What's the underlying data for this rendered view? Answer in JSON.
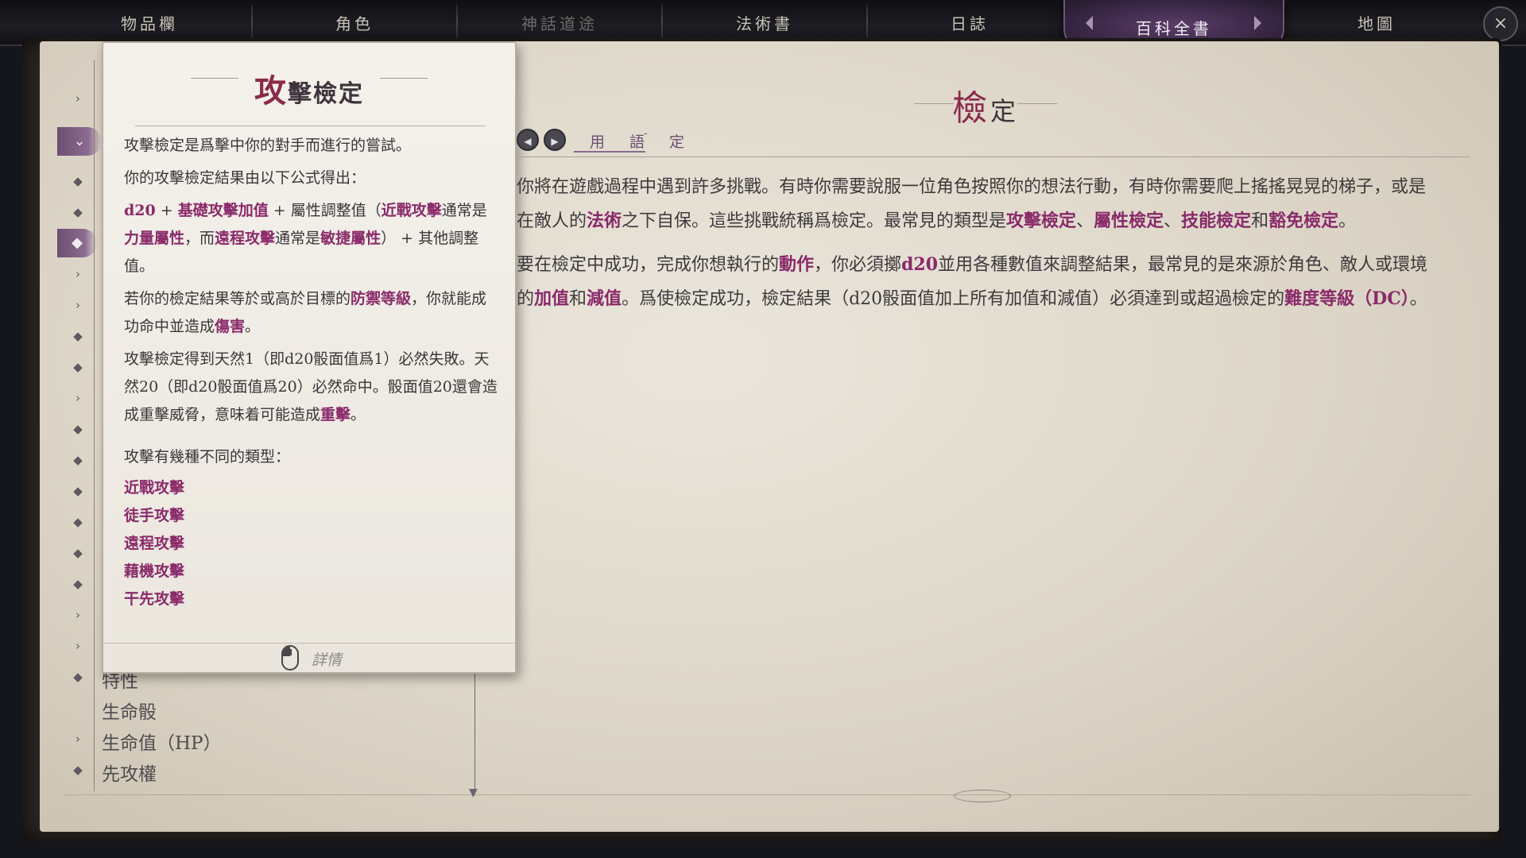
{
  "top_nav": {
    "tabs": [
      {
        "label": "物品欄",
        "state": "normal"
      },
      {
        "label": "角色",
        "state": "normal"
      },
      {
        "label": "神話道途",
        "state": "disabled"
      },
      {
        "label": "法術書",
        "state": "normal"
      },
      {
        "label": "日誌",
        "state": "normal"
      },
      {
        "label": "百科全書",
        "state": "active"
      },
      {
        "label": "地圖",
        "state": "normal"
      }
    ],
    "close_icon": "×"
  },
  "sidebar": {
    "icons": [
      "chevron-right",
      "chevron-down",
      "diamond",
      "diamond",
      "diamond",
      "chevron-right",
      "chevron-right",
      "diamond",
      "diamond",
      "chevron-right",
      "diamond",
      "diamond",
      "diamond",
      "diamond",
      "diamond",
      "chevron-right",
      "chevron-right",
      "diamond",
      "diamond",
      "chevron-right",
      "diamond"
    ],
    "visible_items": [
      "特性",
      "生命骰",
      "生命值（HP）",
      "先攻權"
    ]
  },
  "tooltip": {
    "title_first": "攻",
    "title_rest": "擊檢定",
    "paragraphs": {
      "p1": "攻擊檢定是爲擊中你的對手而進行的嘗試。",
      "p2": "你的攻擊檢定結果由以下公式得出：",
      "formula": {
        "a": "d20",
        "plus1": " + ",
        "b": "基礎攻擊加值",
        "plus2": " + 屬性調整值（",
        "c": "近戰攻擊",
        "d": "通常是",
        "e": "力量屬性",
        "f": "，而",
        "g": "遠程攻擊",
        "h": "通常是",
        "i": "敏捷屬性",
        "j": "） + 其他調整值。"
      },
      "p4": {
        "a": "若你的檢定結果等於或高於目標的",
        "b": "防禦等級",
        "c": "，你就能成功命中並造成",
        "d": "傷害",
        "e": "。"
      },
      "p5": {
        "a": "攻擊檢定得到天然1（即d20骰面值爲1）必然失敗。天然20（即d20骰面值爲20）必然命中。骰面值20還會造成重擊威脅，意味着可能造成",
        "b": "重擊",
        "c": "。"
      },
      "p6": "攻擊有幾種不同的類型："
    },
    "links": [
      "近戰攻擊",
      "徒手攻擊",
      "遠程攻擊",
      "藉機攻擊",
      "干先攻擊"
    ],
    "footer_label": "詳情"
  },
  "entry": {
    "title_first": "檢",
    "title_rest": "定",
    "breadcrumb": [
      "用　語",
      "-",
      "定"
    ],
    "p1": {
      "a": "你將在遊戲過程中遇到許多挑戰。有時你需要說服一位角色按照你的想法行動，有時你需要爬上搖搖晃晃的梯子，或是在敵人的",
      "b": "法術",
      "c": "之下自保。這些挑戰統稱爲檢定。最常見的類型是",
      "d": "攻擊檢定",
      "e": "、",
      "f": "屬性檢定",
      "g": "、",
      "h": "技能檢定",
      "i": "和",
      "j": "豁免檢定",
      "k": "。"
    },
    "p2": {
      "a": "要在檢定中成功，完成你想執行的",
      "b": "動作",
      "c": "，你必須擲",
      "d": "d20",
      "e": "並用各種數值來調整結果，最常見的是來源於角色、敵人或環境的",
      "f": "加值",
      "g": "和",
      "h": "減值",
      "i": "。爲使檢定成功，檢定結果（d20骰面值加上所有加值和減值）必須達到或超過檢定的",
      "j": "難度等級（DC）",
      "k": "。"
    }
  },
  "colors": {
    "accent": "#8a2a6a",
    "title_accent": "#8a2a4a",
    "active_tab": "#3a2746",
    "parchment": "#ebe6dc"
  }
}
